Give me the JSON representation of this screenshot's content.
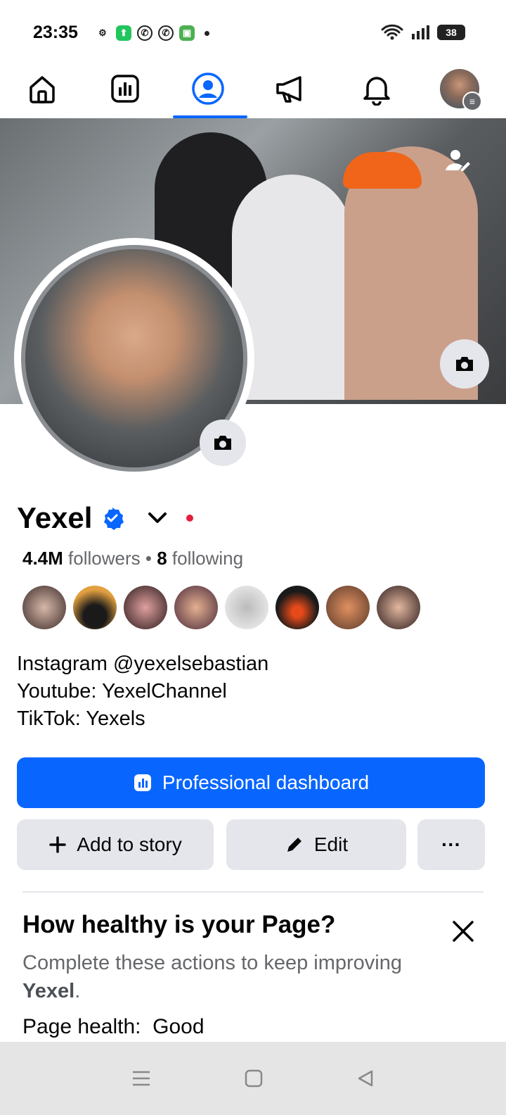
{
  "status_bar": {
    "time": "23:35",
    "battery": "38",
    "icons": [
      "gear-icon",
      "app-green-icon",
      "whatsapp-icon",
      "whatsapp-icon",
      "app-green-icon"
    ]
  },
  "nav": {
    "items": [
      "home",
      "dashboard",
      "profile",
      "announcements",
      "notifications",
      "account"
    ],
    "active": "profile"
  },
  "profile": {
    "name": "Yexel",
    "followers_count": "4.4M",
    "followers_label": "followers",
    "following_count": "8",
    "following_label": "following",
    "bio": [
      "Instagram @yexelsebastian",
      "Youtube: YexelChannel",
      "TikTok: Yexels"
    ]
  },
  "buttons": {
    "professional_dashboard": "Professional dashboard",
    "add_to_story": "Add to story",
    "edit": "Edit",
    "more": "···"
  },
  "health": {
    "title": "How healthy is your Page?",
    "subtitle_prefix": "Complete these actions to keep improving ",
    "subtitle_name": "Yexel",
    "subtitle_suffix": ".",
    "status_label": "Page health:",
    "status_value": "Good"
  },
  "colors": {
    "accent": "#0866ff",
    "button_gray": "#e4e6eb",
    "notification_dot": "#e41e3f"
  }
}
